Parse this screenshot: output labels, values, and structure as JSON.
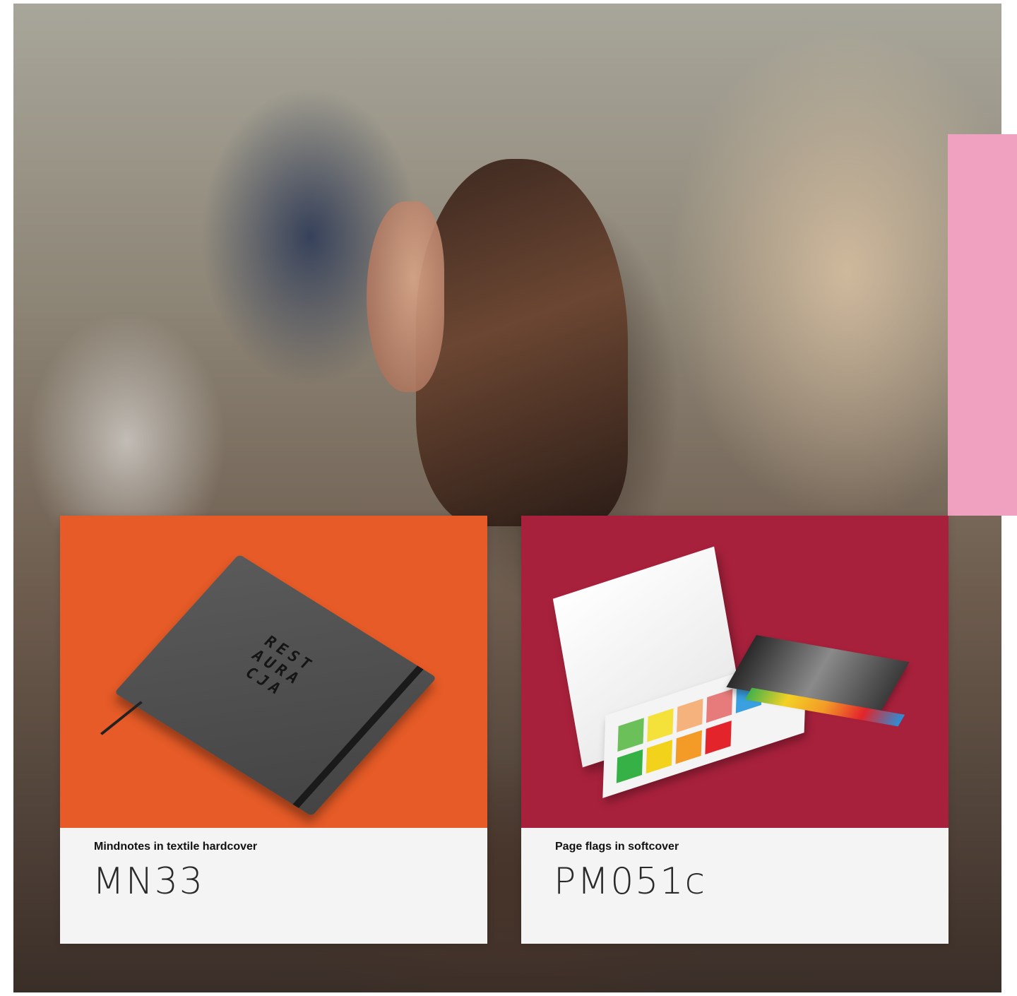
{
  "cards": [
    {
      "subtitle": "Mindnotes in textile hardcover",
      "code": "MN33",
      "image_background": "#e65b27",
      "image_alt": "grey notebook with elastic band"
    },
    {
      "subtitle": "Page flags in softcover",
      "code": "PM051c",
      "image_background": "#a8213c",
      "image_alt": "page flags set in white softcover"
    }
  ],
  "colors": {
    "accent_pink": "#f1a1c0",
    "card_text_bg": "#f4f4f4"
  }
}
